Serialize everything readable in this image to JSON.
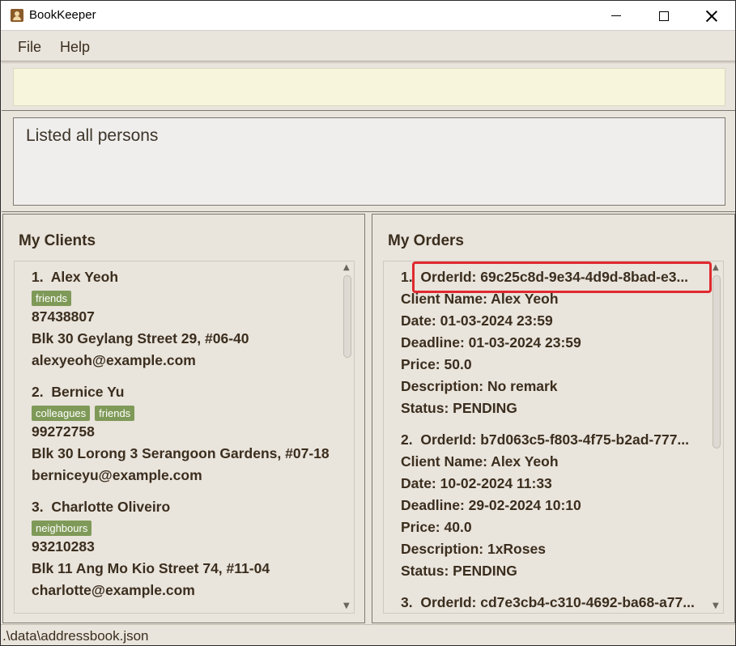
{
  "window": {
    "title": "BookKeeper"
  },
  "menu": {
    "file": "File",
    "help": "Help"
  },
  "command": {
    "value": "",
    "placeholder": ""
  },
  "result": {
    "text": "Listed all persons"
  },
  "clients": {
    "title": "My Clients",
    "items": [
      {
        "index": "1.",
        "name": "Alex Yeoh",
        "tags": [
          "friends"
        ],
        "phone": "87438807",
        "address": "Blk 30 Geylang Street 29, #06-40",
        "email": "alexyeoh@example.com"
      },
      {
        "index": "2.",
        "name": "Bernice Yu",
        "tags": [
          "colleagues",
          "friends"
        ],
        "phone": "99272758",
        "address": "Blk 30 Lorong 3 Serangoon Gardens, #07-18",
        "email": "berniceyu@example.com"
      },
      {
        "index": "3.",
        "name": "Charlotte Oliveiro",
        "tags": [
          "neighbours"
        ],
        "phone": "93210283",
        "address": "Blk 11 Ang Mo Kio Street 74, #11-04",
        "email": "charlotte@example.com"
      }
    ]
  },
  "orders": {
    "title": "My Orders",
    "items": [
      {
        "index": "1.",
        "order_id": "OrderId: 69c25c8d-9e34-4d9d-8bad-e3...",
        "client": "Client Name: Alex Yeoh",
        "date": "Date: 01-03-2024 23:59",
        "deadline": "Deadline: 01-03-2024 23:59",
        "price": "Price: 50.0",
        "description": "Description: No remark",
        "status": "Status: PENDING"
      },
      {
        "index": "2.",
        "order_id": "OrderId: b7d063c5-f803-4f75-b2ad-777...",
        "client": "Client Name: Alex Yeoh",
        "date": "Date: 10-02-2024 11:33",
        "deadline": "Deadline: 29-02-2024 10:10",
        "price": "Price: 40.0",
        "description": "Description: 1xRoses",
        "status": "Status: PENDING"
      },
      {
        "index": "3.",
        "order_id": "OrderId: cd7e3cb4-c310-4692-ba68-a77..."
      }
    ]
  },
  "status_bar": {
    "path": ".\\data\\addressbook.json"
  },
  "colors": {
    "tag": "#7f9a58",
    "highlight": "#e0292f",
    "command_bg": "#f7f5dc",
    "window_bg": "#e9e4dc"
  }
}
